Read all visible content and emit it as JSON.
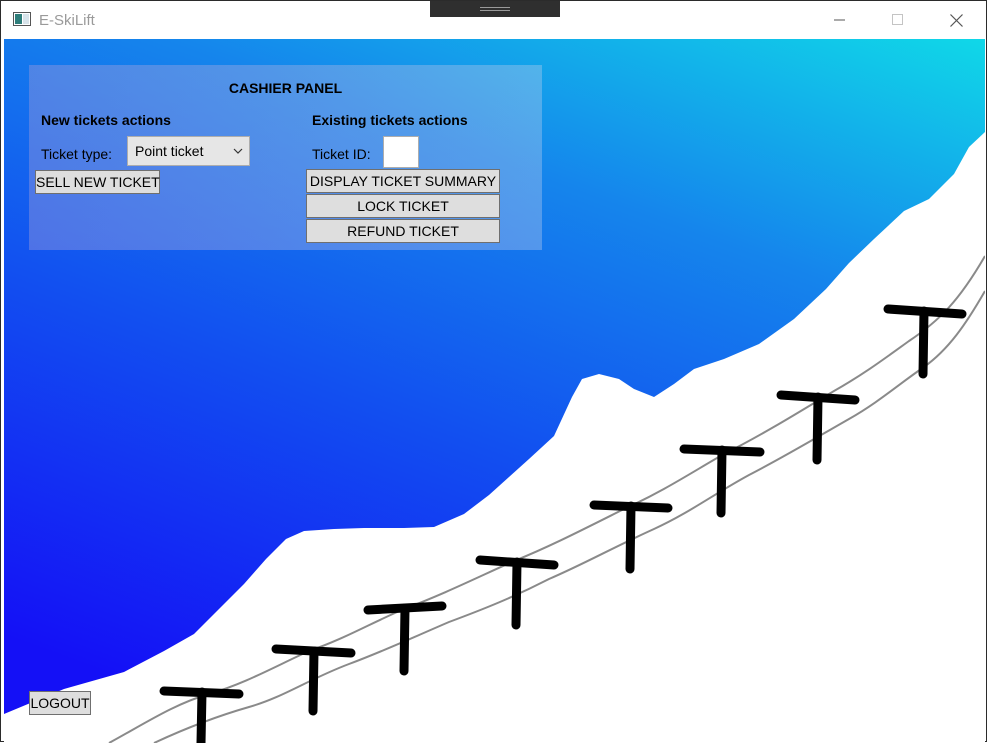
{
  "window": {
    "title": "E-SkiLift",
    "icons": {
      "app": "window-app-icon",
      "minimize": "minimize-icon",
      "maximize": "maximize-icon",
      "close": "close-icon"
    }
  },
  "panel": {
    "title": "CASHIER PANEL",
    "new_section": {
      "heading": "New tickets actions",
      "ticket_type_label": "Ticket type:",
      "ticket_type_value": "Point ticket",
      "sell_button": "SELL NEW TICKET"
    },
    "existing_section": {
      "heading": "Existing tickets actions",
      "ticket_id_label": "Ticket ID:",
      "ticket_id_value": "",
      "display_button": "DISPLAY TICKET SUMMARY",
      "lock_button": "LOCK TICKET",
      "refund_button": "REFUND TICKET"
    }
  },
  "footer": {
    "logout_button": "LOGOUT"
  },
  "colors": {
    "sky_top_right": "#10d8e8",
    "sky_bottom_left": "#1410f6",
    "snow": "#ffffff",
    "lift_tower": "#000000",
    "cable": "#808080"
  }
}
